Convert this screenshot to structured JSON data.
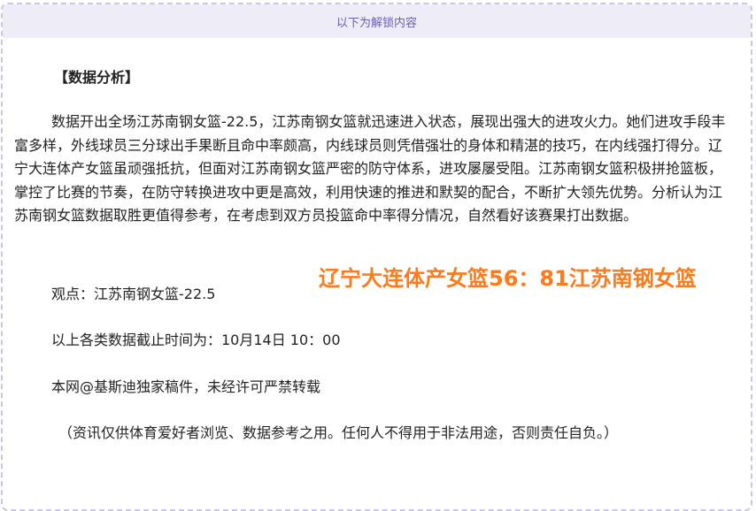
{
  "header": {
    "unlock_label": "以下为解锁内容"
  },
  "article": {
    "section_title": "【数据分析】",
    "analysis_text": "数据开出全场江苏南钢女篮-22.5，江苏南钢女篮就迅速进入状态，展现出强大的进攻火力。她们进攻手段丰富多样，外线球员三分球出手果断且命中率颇高，内线球员则凭借强壮的身体和精湛的技巧，在内线强打得分。辽宁大连体产女篮虽顽强抵抗，但面对江苏南钢女篮严密的防守体系，进攻屡屡受阻。江苏南钢女篮积极拼抢篮板，掌控了比赛的节奏，在防守转换进攻中更是高效，利用快速的推进和默契的配合，不断扩大领先优势。分析认为江苏南钢女篮数据取胜更值得参考，在考虑到双方员投篮命中率得分情况，自然看好该赛果打出数据。",
    "score_line": "辽宁大连体产女篮56：81江苏南钢女篮",
    "viewpoint": "观点：江苏南钢女篮-22.5",
    "cutoff_time": "以上各类数据截止时间为：10月14日 10：00",
    "copyright": "本网@基斯迪独家稿件，未经许可严禁转载",
    "disclaimer": "（资讯仅供体育爱好者浏览、数据参考之用。任何人不得用于非法用途，否则责任自负。）"
  },
  "colors": {
    "score_accent": "#ff7a1a",
    "header_bg": "#eeecf7",
    "header_text": "#6a5fb0",
    "dashed_border": "#c9c6e6"
  }
}
